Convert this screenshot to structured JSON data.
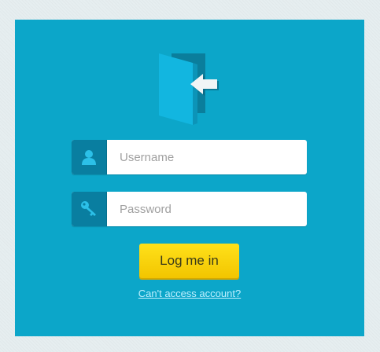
{
  "colors": {
    "page_background": "#e6eef0",
    "panel_background": "#0ca6c9",
    "icon_box": "#097ea0",
    "button": "#f2c500",
    "link": "#bff0ff"
  },
  "logo": {
    "icon": "door-enter-icon"
  },
  "form": {
    "username": {
      "placeholder": "Username",
      "value": "",
      "icon": "user-icon"
    },
    "password": {
      "placeholder": "Password",
      "value": "",
      "icon": "key-icon"
    },
    "submit_label": "Log me in",
    "forgot_link": "Can't access account?"
  }
}
